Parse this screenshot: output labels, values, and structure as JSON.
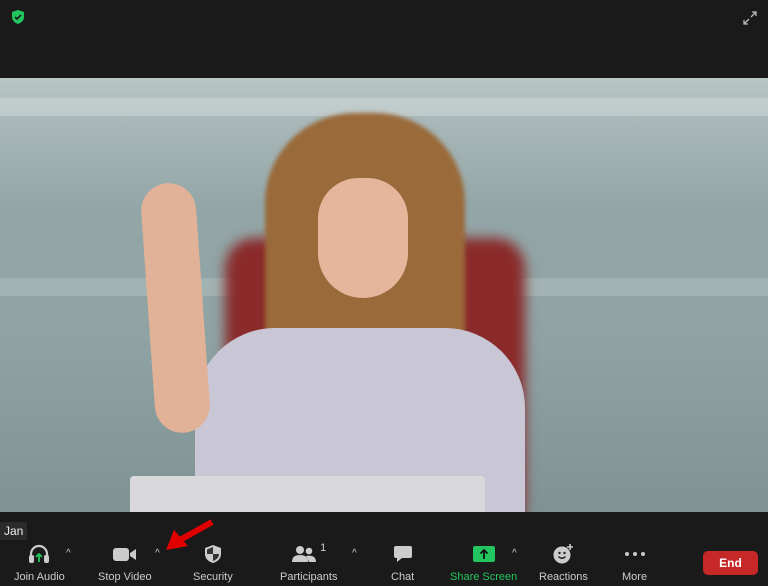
{
  "participant_name": "Jan",
  "toolbar": {
    "join_audio": "Join Audio",
    "stop_video": "Stop Video",
    "security": "Security",
    "participants": "Participants",
    "participants_count": "1",
    "chat": "Chat",
    "share_screen": "Share Screen",
    "reactions": "Reactions",
    "more": "More",
    "end": "End"
  },
  "colors": {
    "accent_green": "#22c55e",
    "end_red": "#c62828",
    "annotation_arrow": "#e00000"
  }
}
